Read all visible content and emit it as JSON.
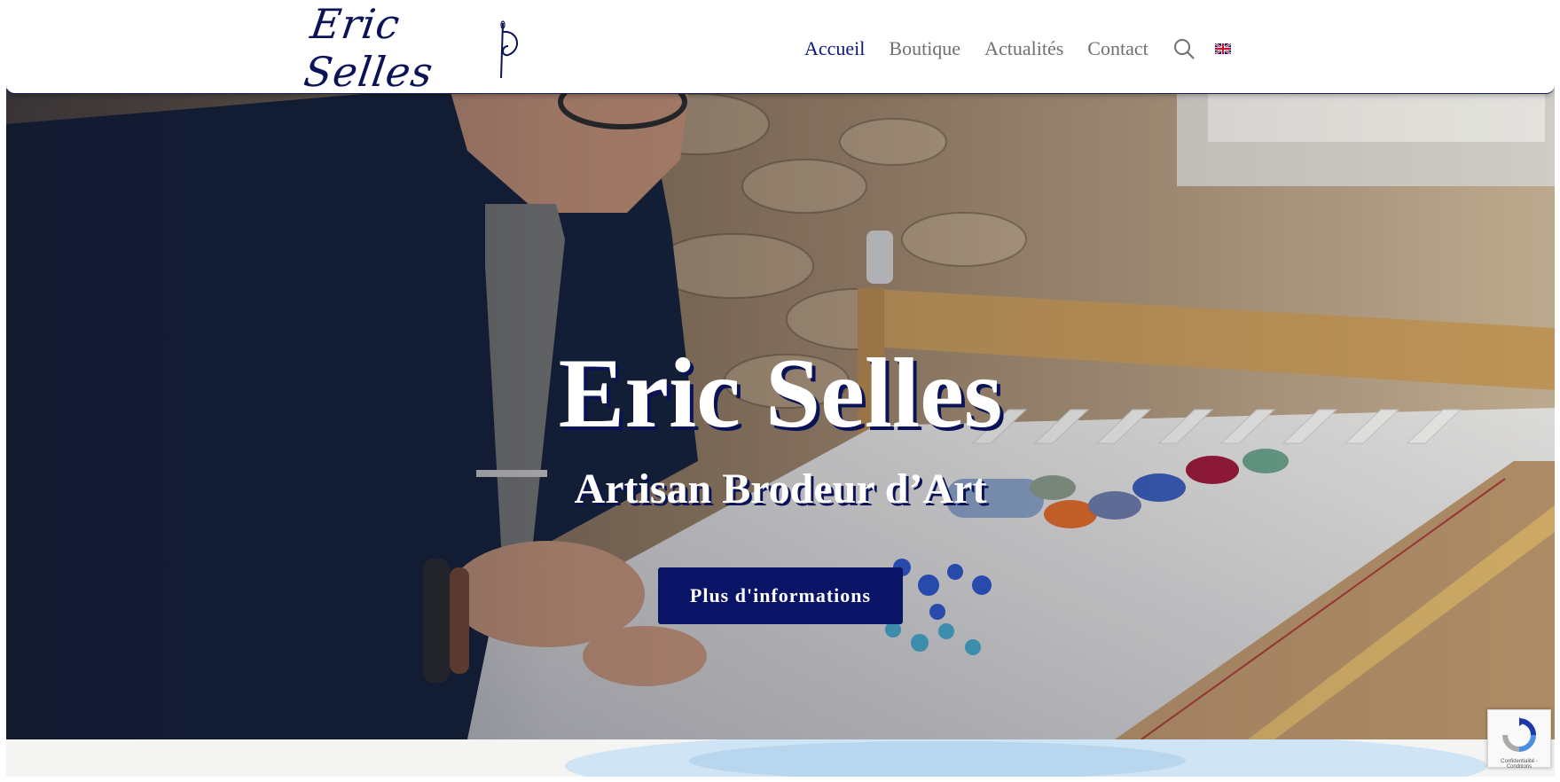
{
  "header": {
    "logo_text": "Eric Selles",
    "nav": [
      {
        "label": "Accueil",
        "active": true
      },
      {
        "label": "Boutique",
        "active": false
      },
      {
        "label": "Actualités",
        "active": false
      },
      {
        "label": "Contact",
        "active": false
      }
    ],
    "search_icon": "search-icon",
    "language_flag": "uk-flag-icon"
  },
  "hero": {
    "title": "Eric Selles",
    "subtitle": "Artisan Brodeur d’Art",
    "button_label": "Plus d'informations"
  },
  "recaptcha": {
    "text": "Confidentialité - Conditions"
  },
  "colors": {
    "brand_navy": "#0a1466",
    "nav_active": "#0b1a78",
    "nav_inactive": "#707070"
  }
}
